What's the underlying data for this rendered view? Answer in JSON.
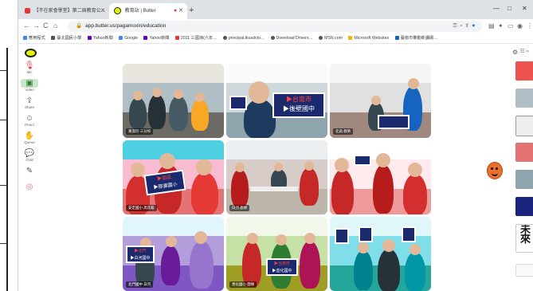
{
  "tabs": [
    {
      "label": "【不在家會學堂】第二屆教育公…",
      "active": false
    },
    {
      "label": "教育站 | Butter",
      "active": true
    }
  ],
  "new_tab_label": "+",
  "window_controls": [
    "—",
    "□",
    "✕"
  ],
  "address": {
    "url": "app.butter.us/pagamoxin/education",
    "icons": [
      "key-icon",
      "zoom-icon",
      "share-icon",
      "star-icon",
      "extension-icon",
      "puzzle-icon",
      "sidebar-icon",
      "profile-icon"
    ]
  },
  "bookmarks": [
    {
      "label": "應用程式",
      "color": "#4285f4"
    },
    {
      "label": "臺北國民小學",
      "color": "#555555"
    },
    {
      "label": "Yahoo新聞",
      "color": "#6001d2"
    },
    {
      "label": "Google",
      "color": "#4285f4"
    },
    {
      "label": "Yahoo新聞",
      "color": "#6001d2"
    },
    {
      "label": "2011 三國演(六年…",
      "color": "#e53935"
    },
    {
      "label": "principal.tkusdcto…",
      "color": "#555555"
    },
    {
      "label": "Download Drivers…",
      "color": "#555555"
    },
    {
      "label": "MSN.com",
      "color": "#555555"
    },
    {
      "label": "Microsoft Websites",
      "color": "#f4b400"
    },
    {
      "label": "臺南市推動新課綱…",
      "color": "#1565c0"
    }
  ],
  "left_tools": [
    {
      "name": "mic",
      "label": "Mic",
      "glyph": "🎙"
    },
    {
      "name": "video",
      "label": "Video",
      "glyph": "▣"
    },
    {
      "name": "share",
      "label": "Share",
      "glyph": "⇪"
    },
    {
      "name": "react",
      "label": "React",
      "glyph": "☺"
    },
    {
      "name": "queue",
      "label": "Queue",
      "glyph": "✋"
    },
    {
      "name": "chat",
      "label": "Chat",
      "glyph": "💬"
    },
    {
      "name": "notes",
      "label": "",
      "glyph": "✎"
    },
    {
      "name": "more",
      "label": "",
      "glyph": "◎"
    }
  ],
  "tiles": [
    {
      "name": "黃淑珍 三分校",
      "sign_red": "",
      "sign_white": "",
      "color": "#cfd8dc"
    },
    {
      "name": "",
      "sign_red": "▶台南市",
      "sign_white": "▶後壁國中",
      "color": "#e0e0e0"
    },
    {
      "name": "北高 教師",
      "sign_red": "",
      "sign_white": "",
      "color": "#d7ccc8"
    },
    {
      "name": "安定國小 高年級",
      "sign_red": "▶南區",
      "sign_white": "▶那婆國小",
      "color": "#f48fb1"
    },
    {
      "name": "白河 教師",
      "sign_red": "",
      "sign_white": "",
      "color": "#c8c3b5"
    },
    {
      "name": "",
      "sign_red": "",
      "sign_white": "",
      "color": "#ffcdd2"
    },
    {
      "name": "北門國中 白河",
      "sign_red": "▶北門",
      "sign_white": "▶白河國中",
      "color": "#b3e5fc"
    },
    {
      "name": "善化國小 團隊",
      "sign_red": "▶台南市",
      "sign_white": "▶善化國中",
      "color": "#dcedc8"
    },
    {
      "name": "",
      "sign_red": "",
      "sign_white": "",
      "color": "#b2ebf2"
    }
  ],
  "right_top_buttons": [
    "⚙",
    "☷ ‹›"
  ],
  "right_thumbs": 9,
  "right_caption": "未來"
}
